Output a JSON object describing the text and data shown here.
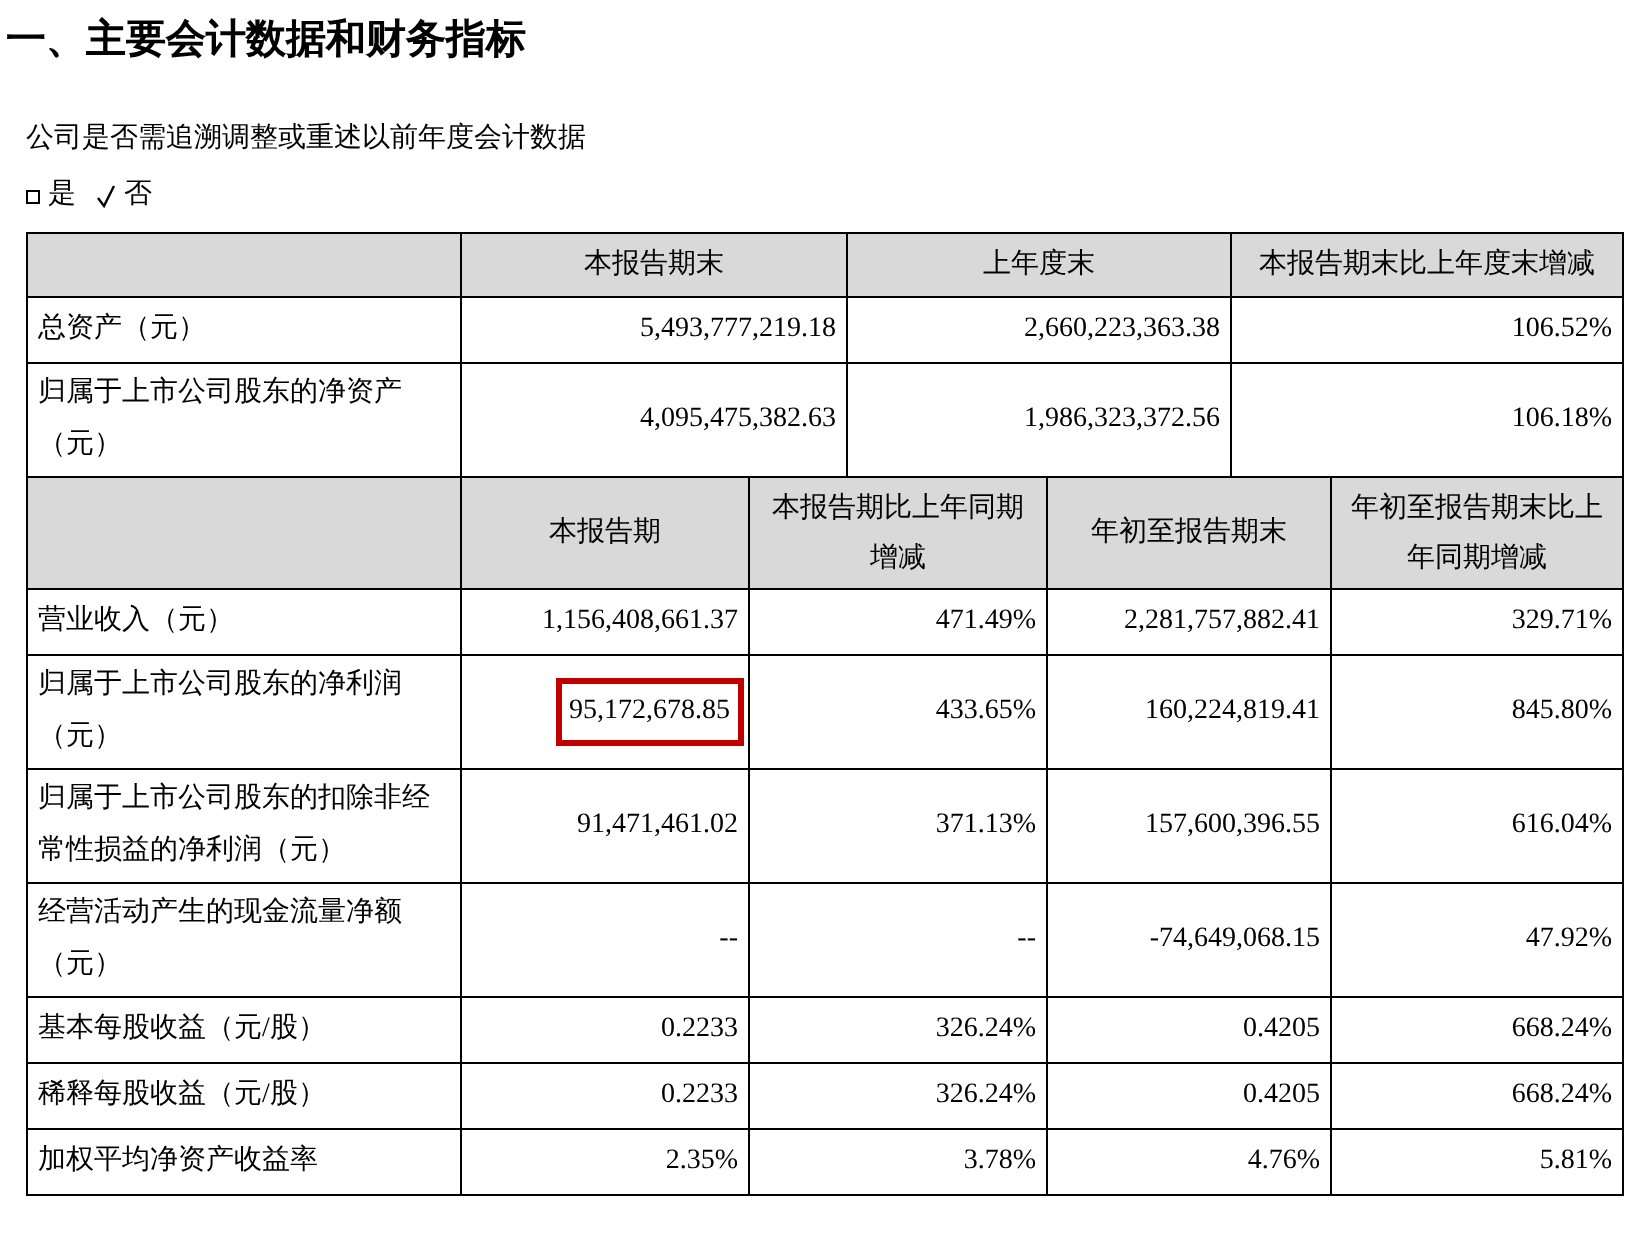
{
  "title": "一、主要会计数据和财务指标",
  "question": "公司是否需追溯调整或重述以前年度会计数据",
  "options": [
    {
      "label": "是",
      "selected": false
    },
    {
      "label": "否",
      "selected": true
    }
  ],
  "balance_table": {
    "columns": [
      "本报告期末",
      "上年度末",
      "本报告期末比上年度末增减"
    ],
    "rows": [
      {
        "label": "总资产（元）",
        "values": [
          "5,493,777,219.18",
          "2,660,223,363.38",
          "106.52%"
        ]
      },
      {
        "label": "归属于上市公司股东的净资产（元）",
        "values": [
          "4,095,475,382.63",
          "1,986,323,372.56",
          "106.18%"
        ]
      }
    ]
  },
  "income_table": {
    "columns": [
      "本报告期",
      "本报告期比上年同期增减",
      "年初至报告期末",
      "年初至报告期末比上年同期增减"
    ],
    "rows": [
      {
        "label": "营业收入（元）",
        "cells": [
          {
            "text": "1,156,408,661.37",
            "highlighted": false
          },
          {
            "text": "471.49%",
            "highlighted": false
          },
          {
            "text": "2,281,757,882.41",
            "highlighted": false
          },
          {
            "text": "329.71%",
            "highlighted": false
          }
        ]
      },
      {
        "label": "归属于上市公司股东的净利润（元）",
        "cells": [
          {
            "text": "95,172,678.85",
            "highlighted": true
          },
          {
            "text": "433.65%",
            "highlighted": false
          },
          {
            "text": "160,224,819.41",
            "highlighted": false
          },
          {
            "text": "845.80%",
            "highlighted": false
          }
        ]
      },
      {
        "label": "归属于上市公司股东的扣除非经常性损益的净利润（元）",
        "cells": [
          {
            "text": "91,471,461.02",
            "highlighted": false
          },
          {
            "text": "371.13%",
            "highlighted": false
          },
          {
            "text": "157,600,396.55",
            "highlighted": false
          },
          {
            "text": "616.04%",
            "highlighted": false
          }
        ]
      },
      {
        "label": "经营活动产生的现金流量净额（元）",
        "cells": [
          {
            "text": "--",
            "highlighted": false
          },
          {
            "text": "--",
            "highlighted": false
          },
          {
            "text": "-74,649,068.15",
            "highlighted": false
          },
          {
            "text": "47.92%",
            "highlighted": false
          }
        ]
      },
      {
        "label": "基本每股收益（元/股）",
        "cells": [
          {
            "text": "0.2233",
            "highlighted": false
          },
          {
            "text": "326.24%",
            "highlighted": false
          },
          {
            "text": "0.4205",
            "highlighted": false
          },
          {
            "text": "668.24%",
            "highlighted": false
          }
        ]
      },
      {
        "label": "稀释每股收益（元/股）",
        "cells": [
          {
            "text": "0.2233",
            "highlighted": false
          },
          {
            "text": "326.24%",
            "highlighted": false
          },
          {
            "text": "0.4205",
            "highlighted": false
          },
          {
            "text": "668.24%",
            "highlighted": false
          }
        ]
      },
      {
        "label": "加权平均净资产收益率",
        "cells": [
          {
            "text": "2.35%",
            "highlighted": false
          },
          {
            "text": "3.78%",
            "highlighted": false
          },
          {
            "text": "4.76%",
            "highlighted": false
          },
          {
            "text": "5.81%",
            "highlighted": false
          }
        ]
      }
    ]
  }
}
